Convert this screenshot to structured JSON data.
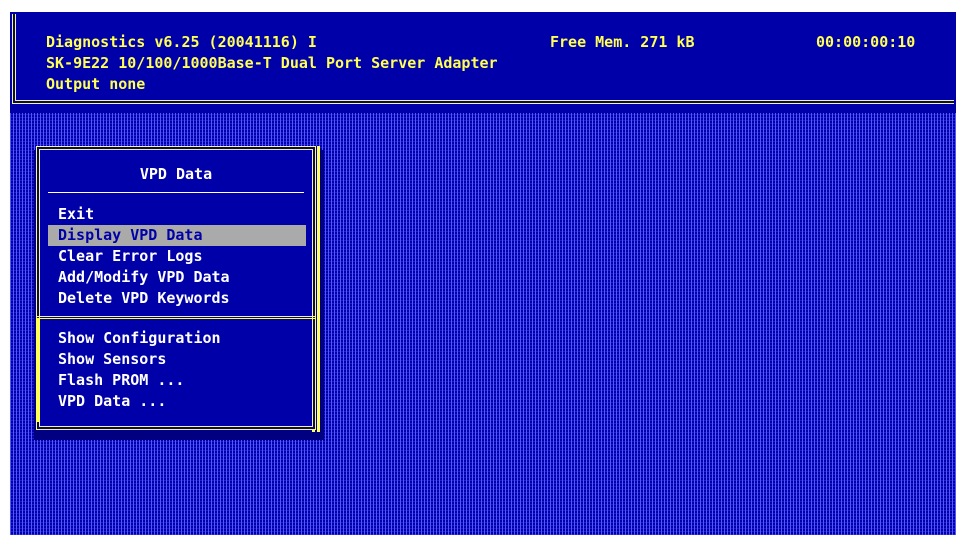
{
  "header": {
    "app_title": "Diagnostics v6.25 (20041116) I",
    "free_mem": "Free Mem. 271 kB",
    "clock": "00:00:00:10",
    "adapter": "SK-9E22 10/100/1000Base-T Dual Port Server Adapter",
    "output": "Output none"
  },
  "menu": {
    "title": "VPD Data",
    "group1": [
      {
        "label": "Exit",
        "selected": false
      },
      {
        "label": "Display VPD Data",
        "selected": true
      },
      {
        "label": "Clear Error Logs",
        "selected": false
      },
      {
        "label": "Add/Modify VPD Data",
        "selected": false
      },
      {
        "label": "Delete VPD Keywords",
        "selected": false
      }
    ],
    "group2": [
      {
        "label": "Show Configuration"
      },
      {
        "label": "Show Sensors"
      },
      {
        "label": "Flash PROM ..."
      },
      {
        "label": "VPD Data ..."
      }
    ]
  },
  "colors": {
    "background": "#0000a8",
    "text_yellow": "#ffff55",
    "text_white": "#ffffff",
    "selection": "#aaaaaa"
  }
}
